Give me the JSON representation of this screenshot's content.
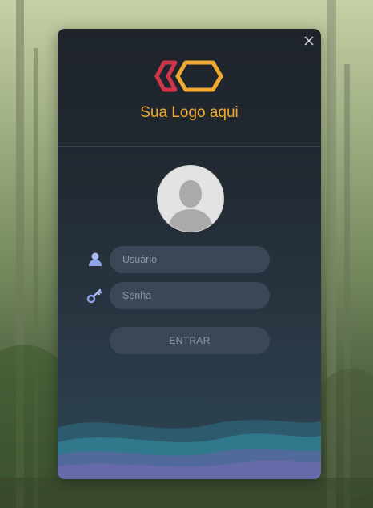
{
  "dialog": {
    "logo_text": "Sua Logo aqui",
    "username_placeholder": "Usuário",
    "password_placeholder": "Senha",
    "submit_label": "ENTRAR"
  },
  "icons": {
    "close": "close-icon",
    "user": "user-icon",
    "password": "key-icon",
    "avatar": "user-silhouette"
  },
  "colors": {
    "brand_orange": "#f0a830",
    "brand_red": "#d0354a",
    "card_bg": "#222a33",
    "input_bg": "#3a4756"
  }
}
